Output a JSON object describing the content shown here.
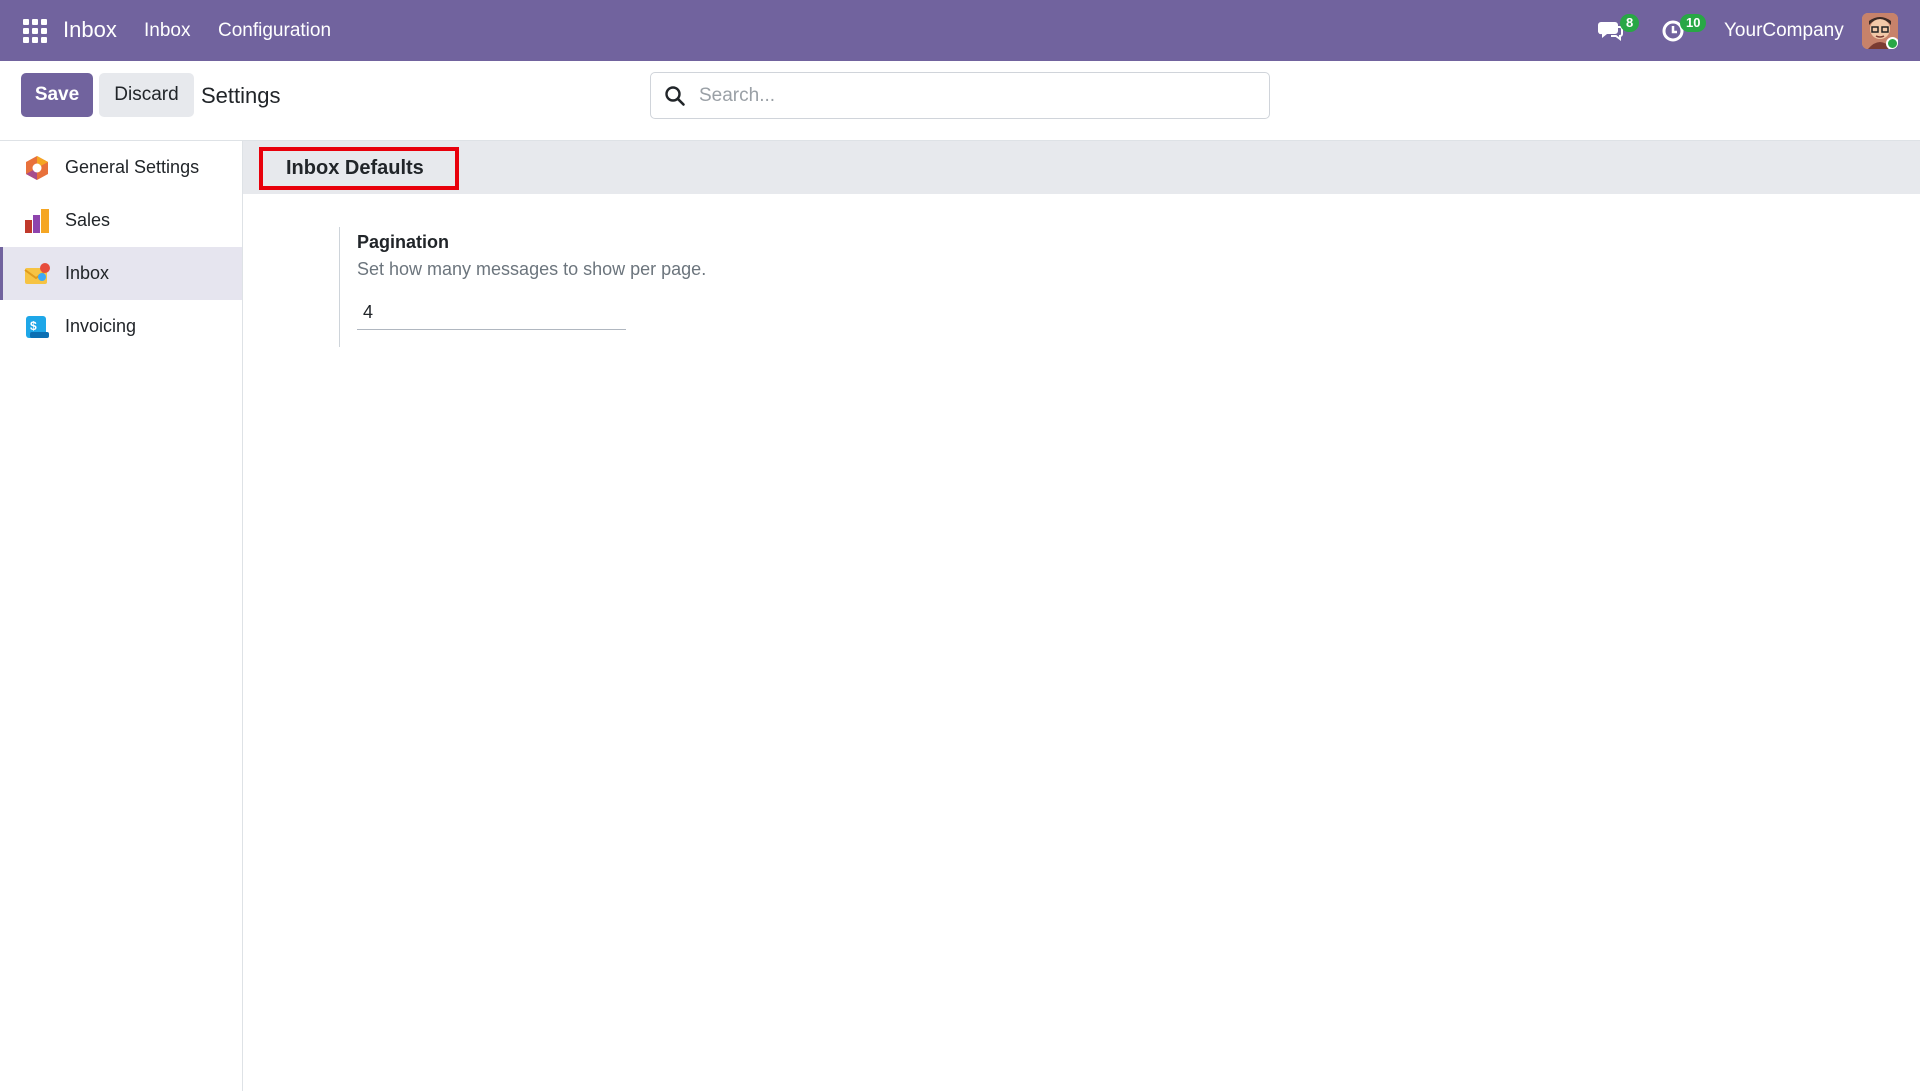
{
  "navbar": {
    "brand": "Inbox",
    "menu": [
      "Inbox",
      "Configuration"
    ],
    "chat_badge": "8",
    "activity_badge": "10",
    "company": "YourCompany"
  },
  "control_panel": {
    "save_label": "Save",
    "discard_label": "Discard",
    "title": "Settings",
    "search_placeholder": "Search..."
  },
  "sidebar": {
    "items": [
      {
        "label": "General Settings",
        "icon": "general-settings-icon",
        "active": false
      },
      {
        "label": "Sales",
        "icon": "sales-icon",
        "active": false
      },
      {
        "label": "Inbox",
        "icon": "inbox-app-icon",
        "active": true
      },
      {
        "label": "Invoicing",
        "icon": "invoicing-icon",
        "active": false
      }
    ]
  },
  "section": {
    "title": "Inbox Defaults",
    "highlight_color": "#e8000b"
  },
  "setting": {
    "label": "Pagination",
    "help": "Set how many messages to show per page.",
    "value": "4"
  },
  "colors": {
    "brand": "#71639e",
    "badge": "#28a745"
  }
}
